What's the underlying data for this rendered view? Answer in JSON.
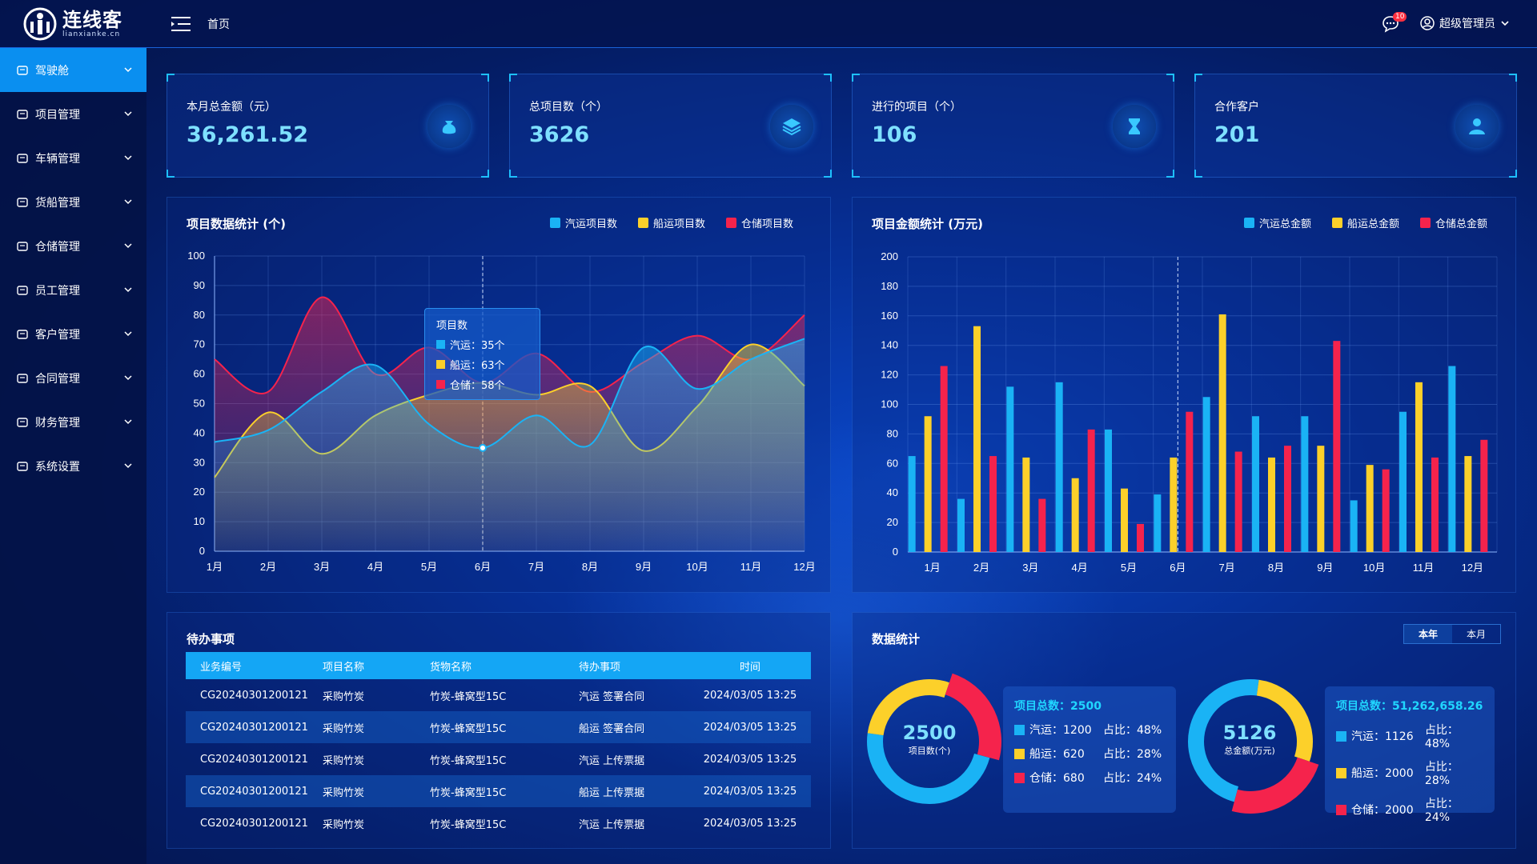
{
  "header": {
    "logo_cn": "连线客",
    "logo_en": "lianxianke.cn",
    "breadcrumb": "首页",
    "message_count": "10",
    "user_name": "超级管理员"
  },
  "sidebar": {
    "items": [
      {
        "label": "驾驶舱",
        "icon": "dashboard-icon"
      },
      {
        "label": "项目管理",
        "icon": "project-icon"
      },
      {
        "label": "车辆管理",
        "icon": "truck-icon"
      },
      {
        "label": "货船管理",
        "icon": "ship-icon"
      },
      {
        "label": "仓储管理",
        "icon": "warehouse-icon"
      },
      {
        "label": "员工管理",
        "icon": "employee-icon"
      },
      {
        "label": "客户管理",
        "icon": "customer-icon"
      },
      {
        "label": "合同管理",
        "icon": "contract-icon"
      },
      {
        "label": "财务管理",
        "icon": "finance-icon"
      },
      {
        "label": "系统设置",
        "icon": "settings-icon"
      }
    ]
  },
  "cards": [
    {
      "label": "本月总金额（元）",
      "value": "36,261.52",
      "icon": "money-bag-icon"
    },
    {
      "label": "总项目数（个）",
      "value": "3626",
      "icon": "layers-icon"
    },
    {
      "label": "进行的项目（个）",
      "value": "106",
      "icon": "hourglass-icon"
    },
    {
      "label": "合作客户",
      "value": "201",
      "icon": "user-icon"
    }
  ],
  "colors": {
    "blue": "#1ab3f5",
    "yellow": "#fcd02a",
    "red": "#f5234c"
  },
  "line_chart": {
    "title": "项目数据统计 (个)",
    "tooltip": {
      "title": "项目数",
      "rows": [
        "汽运：35个",
        "船运：63个",
        "仓储：58个"
      ]
    },
    "chart_data": {
      "type": "line",
      "categories": [
        "1月",
        "2月",
        "3月",
        "4月",
        "5月",
        "6月",
        "7月",
        "8月",
        "9月",
        "10月",
        "11月",
        "12月"
      ],
      "ylim": [
        0,
        100
      ],
      "yticks": [
        0,
        10,
        20,
        30,
        40,
        50,
        60,
        70,
        80,
        90,
        100
      ],
      "series": [
        {
          "name": "汽运项目数",
          "values": [
            37,
            41,
            54,
            63,
            43,
            35,
            46,
            36,
            69,
            55,
            65,
            72
          ]
        },
        {
          "name": "船运项目数",
          "values": [
            25,
            47,
            33,
            46,
            53,
            57,
            53,
            56,
            34,
            49,
            70,
            56
          ]
        },
        {
          "name": "仓储项目数",
          "values": [
            65,
            54,
            86,
            60,
            69,
            57,
            67,
            54,
            64,
            73,
            65,
            80
          ]
        }
      ]
    }
  },
  "bar_chart": {
    "title": "项目金额统计 (万元)",
    "chart_data": {
      "type": "bar",
      "categories": [
        "1月",
        "2月",
        "3月",
        "4月",
        "5月",
        "6月",
        "7月",
        "8月",
        "9月",
        "10月",
        "11月",
        "12月"
      ],
      "ylim": [
        0,
        200
      ],
      "yticks": [
        0,
        20,
        40,
        60,
        80,
        100,
        120,
        140,
        160,
        180,
        200
      ],
      "series": [
        {
          "name": "汽运总金额",
          "values": [
            65,
            36,
            112,
            115,
            83,
            39,
            105,
            92,
            92,
            35,
            95,
            126
          ]
        },
        {
          "name": "船运总金额",
          "values": [
            92,
            153,
            64,
            50,
            43,
            64,
            161,
            64,
            72,
            59,
            115,
            65
          ]
        },
        {
          "name": "仓储总金额",
          "values": [
            126,
            65,
            36,
            83,
            19,
            95,
            68,
            72,
            143,
            56,
            64,
            76
          ]
        }
      ]
    }
  },
  "todo": {
    "title": "待办事项",
    "headers": [
      "业务编号",
      "项目名称",
      "货物名称",
      "待办事项",
      "时间"
    ],
    "rows": [
      [
        "CG20240301200121",
        "采购竹炭",
        "竹炭-蜂窝型15C",
        "汽运 签署合同",
        "2024/03/05  13:25"
      ],
      [
        "CG20240301200121",
        "采购竹炭",
        "竹炭-蜂窝型15C",
        "船运 签署合同",
        "2024/03/05  13:25"
      ],
      [
        "CG20240301200121",
        "采购竹炭",
        "竹炭-蜂窝型15C",
        "汽运 上传票据",
        "2024/03/05  13:25"
      ],
      [
        "CG20240301200121",
        "采购竹炭",
        "竹炭-蜂窝型15C",
        "船运 上传票据",
        "2024/03/05  13:25"
      ],
      [
        "CG20240301200121",
        "采购竹炭",
        "竹炭-蜂窝型15C",
        "汽运 上传票据",
        "2024/03/05  13:25"
      ]
    ]
  },
  "stats": {
    "title": "数据统计",
    "tabs": [
      "本年",
      "本月"
    ],
    "donut1": {
      "center_value": "2500",
      "center_label": "项目数(个)",
      "box_title": "项目总数：2500",
      "rows": [
        {
          "name": "汽运：1200",
          "share": "占比：48%"
        },
        {
          "name": "船运：620",
          "share": "占比：28%"
        },
        {
          "name": "仓储：680",
          "share": "占比：24%"
        }
      ],
      "shares": [
        48,
        28,
        24
      ]
    },
    "donut2": {
      "center_value": "5126",
      "center_label": "总金额(万元)",
      "box_title": "项目总数：51,262,658.26",
      "rows": [
        {
          "name": "汽运：1126",
          "share": "占比：48%"
        },
        {
          "name": "船运：2000",
          "share": "占比：28%"
        },
        {
          "name": "仓储：2000",
          "share": "占比：24%"
        }
      ],
      "shares": [
        48,
        28,
        24
      ]
    }
  }
}
